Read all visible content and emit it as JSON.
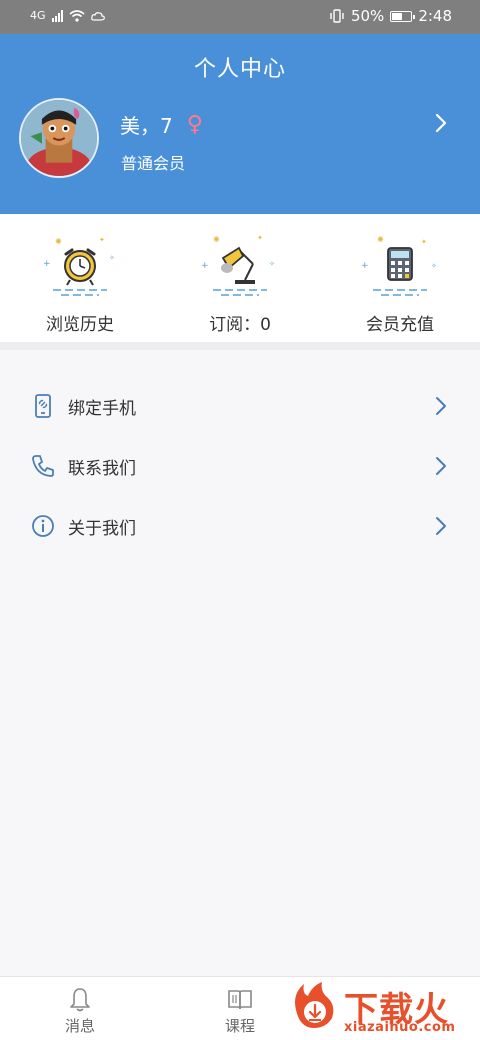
{
  "status_bar": {
    "network": "4G",
    "battery_text": "50%",
    "battery_level": 0.5,
    "time": "2:48"
  },
  "header": {
    "title": "个人中心",
    "username": "美，7",
    "gender_icon": "female-icon",
    "member_level": "普通会员",
    "background_color": "#4a90d9"
  },
  "quick_actions": [
    {
      "label": "浏览历史",
      "icon": "alarm-clock-icon"
    },
    {
      "label": "订阅：0",
      "icon": "desk-lamp-icon"
    },
    {
      "label": "会员充值",
      "icon": "calculator-icon"
    }
  ],
  "menu": [
    {
      "label": "绑定手机",
      "icon": "phone-link-icon"
    },
    {
      "label": "联系我们",
      "icon": "telephone-icon"
    },
    {
      "label": "关于我们",
      "icon": "info-icon"
    }
  ],
  "bottom_nav": [
    {
      "label": "消息",
      "icon": "bell-icon"
    },
    {
      "label": "课程",
      "icon": "book-icon"
    }
  ],
  "watermark": {
    "text": "下载火",
    "url": "xiazaihuo.com"
  }
}
